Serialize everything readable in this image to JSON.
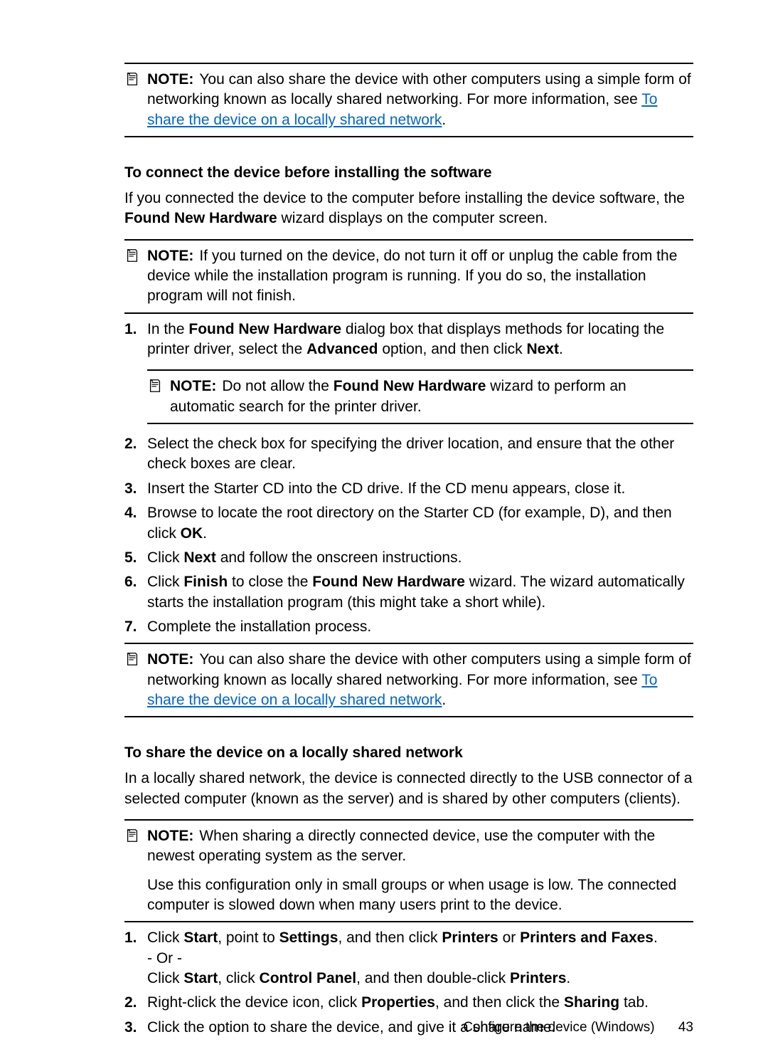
{
  "note1": {
    "label": "NOTE:",
    "pre": "You can also share the device with other computers using a simple form of networking known as locally shared networking. For more information, see ",
    "link": "To share the device on a locally shared network",
    "post": "."
  },
  "sectionA": {
    "heading": "To connect the device before installing the software",
    "intro_pre": "If you connected the device to the computer before installing the device software, the ",
    "intro_bold": "Found New Hardware",
    "intro_post": " wizard displays on the computer screen.",
    "note": {
      "label": "NOTE:",
      "text": "If you turned on the device, do not turn it off or unplug the cable from the device while the installation program is running. If you do so, the installation program will not finish."
    },
    "step1": {
      "num": "1.",
      "pre": "In the ",
      "b1": "Found New Hardware",
      "mid1": " dialog box that displays methods for locating the printer driver, select the ",
      "b2": "Advanced",
      "mid2": " option, and then click ",
      "b3": "Next",
      "post": ".",
      "nested_note": {
        "label": "NOTE:",
        "pre": "Do not allow the ",
        "b": "Found New Hardware",
        "post": " wizard to perform an automatic search for the printer driver."
      }
    },
    "step2": {
      "num": "2.",
      "text": "Select the check box for specifying the driver location, and ensure that the other check boxes are clear."
    },
    "step3": {
      "num": "3.",
      "text": "Insert the Starter CD into the CD drive. If the CD menu appears, close it."
    },
    "step4": {
      "num": "4.",
      "pre": "Browse to locate the root directory on the Starter CD (for example, D), and then click ",
      "b": "OK",
      "post": "."
    },
    "step5": {
      "num": "5.",
      "pre": "Click ",
      "b": "Next",
      "post": " and follow the onscreen instructions."
    },
    "step6": {
      "num": "6.",
      "pre": "Click ",
      "b1": "Finish",
      "mid": " to close the ",
      "b2": "Found New Hardware",
      "post": " wizard. The wizard automatically starts the installation program (this might take a short while)."
    },
    "step7": {
      "num": "7.",
      "text": "Complete the installation process."
    }
  },
  "note3": {
    "label": "NOTE:",
    "pre": "You can also share the device with other computers using a simple form of networking known as locally shared networking. For more information, see ",
    "link": "To share the device on a locally shared network",
    "post": "."
  },
  "sectionB": {
    "heading": "To share the device on a locally shared network",
    "intro": "In a locally shared network, the device is connected directly to the USB connector of a selected computer (known as the server) and is shared by other computers (clients).",
    "note": {
      "label": "NOTE:",
      "p1": "When sharing a directly connected device, use the computer with the newest operating system as the server.",
      "p2": "Use this configuration only in small groups or when usage is low. The connected computer is slowed down when many users print to the device."
    },
    "step1": {
      "num": "1.",
      "l1_pre": "Click ",
      "l1_b1": "Start",
      "l1_m1": ", point to ",
      "l1_b2": "Settings",
      "l1_m2": ", and then click ",
      "l1_b3": "Printers",
      "l1_m3": " or ",
      "l1_b4": "Printers and Faxes",
      "l1_post": ".",
      "or": "- Or -",
      "l2_pre": "Click ",
      "l2_b1": "Start",
      "l2_m1": ", click ",
      "l2_b2": "Control Panel",
      "l2_m2": ", and then double-click ",
      "l2_b3": "Printers",
      "l2_post": "."
    },
    "step2": {
      "num": "2.",
      "pre": "Right-click the device icon, click ",
      "b1": "Properties",
      "mid": ", and then click the ",
      "b2": "Sharing",
      "post": " tab."
    },
    "step3": {
      "num": "3.",
      "text": "Click the option to share the device, and give it a share name."
    }
  },
  "footer": {
    "title": "Configure the device (Windows)",
    "page": "43"
  }
}
